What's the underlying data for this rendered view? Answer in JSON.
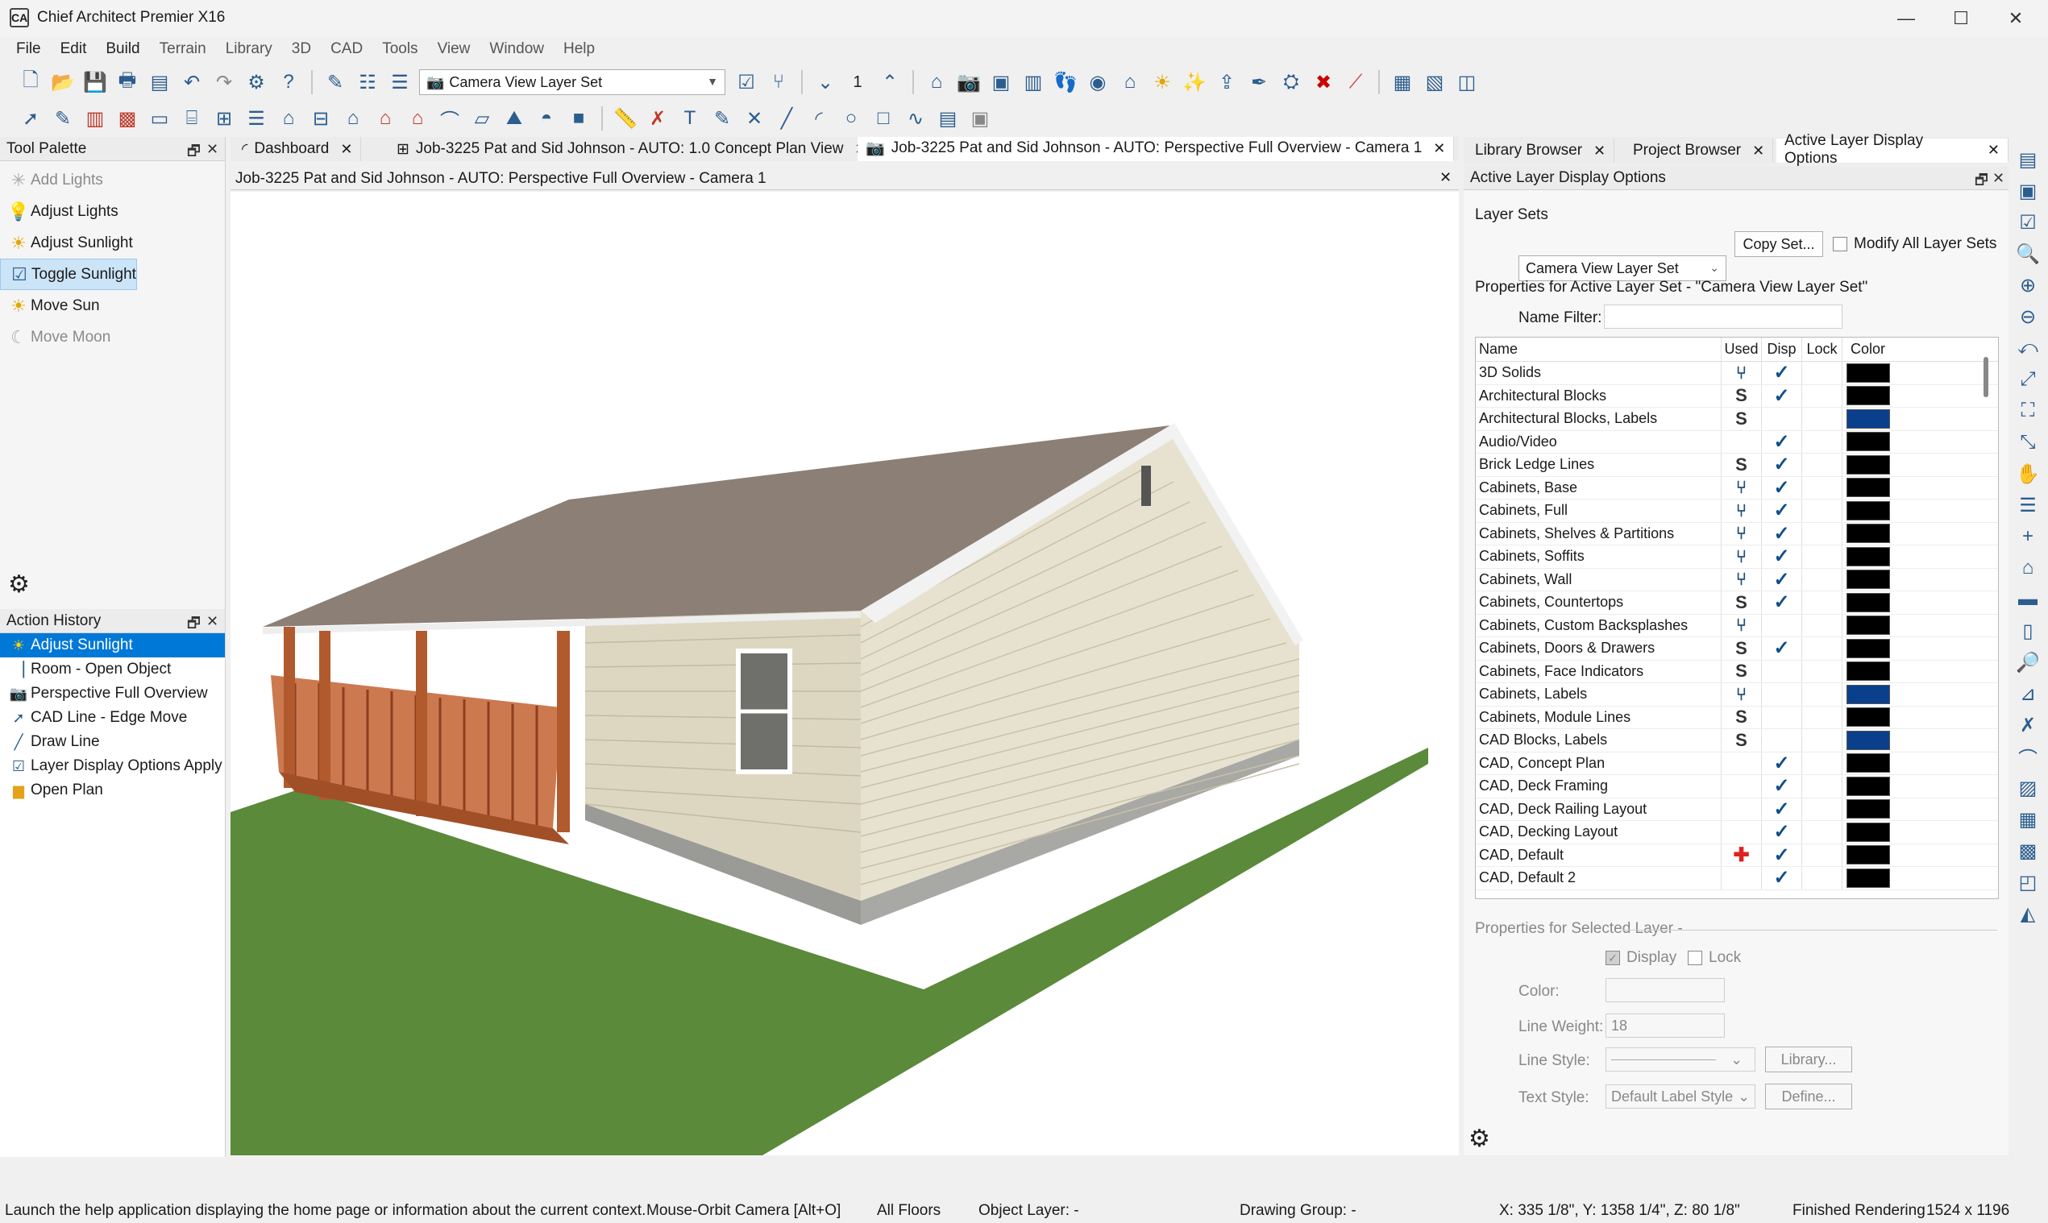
{
  "app": {
    "title": "Chief Architect Premier X16"
  },
  "window_controls": {
    "minimize": "—",
    "maximize": "☐",
    "close": "✕"
  },
  "menu": [
    "File",
    "Edit",
    "Build",
    "Terrain",
    "Library",
    "3D",
    "CAD",
    "Tools",
    "View",
    "Window",
    "Help"
  ],
  "toolbar": {
    "layer_set": "Camera View Layer Set",
    "floor_number": "1"
  },
  "tool_palette": {
    "title": "Tool Palette",
    "items": [
      {
        "label": "Add Lights",
        "icon": "add-light-icon",
        "state": "disabled"
      },
      {
        "label": "Adjust Lights",
        "icon": "adjust-lights-icon",
        "state": "normal"
      },
      {
        "label": "Adjust Sunlight",
        "icon": "adjust-sunlight-icon",
        "state": "normal"
      },
      {
        "label": "Toggle Sunlight",
        "icon": "toggle-sunlight-icon",
        "state": "selected"
      },
      {
        "label": "Move Sun",
        "icon": "sun-icon",
        "state": "normal"
      },
      {
        "label": "Move Moon",
        "icon": "moon-icon",
        "state": "disabled"
      }
    ]
  },
  "action_history": {
    "title": "Action History",
    "items": [
      {
        "label": "Adjust Sunlight",
        "selected": true
      },
      {
        "label": "Room - Open Object",
        "selected": false
      },
      {
        "label": "Perspective Full Overview",
        "selected": false
      },
      {
        "label": "CAD Line - Edge Move",
        "selected": false
      },
      {
        "label": "Draw Line",
        "selected": false
      },
      {
        "label": "Layer Display Options Apply",
        "selected": false
      },
      {
        "label": "Open Plan",
        "selected": false
      }
    ]
  },
  "doc_tabs": [
    {
      "label": "Dashboard",
      "active": false
    },
    {
      "label": "Job-3225 Pat and Sid Johnson - AUTO: 1.0 Concept Plan View",
      "active": false
    },
    {
      "label": "Job-3225 Pat and Sid Johnson - AUTO: Perspective Full Overview - Camera 1",
      "active": true
    }
  ],
  "view": {
    "title": "Job-3225 Pat and Sid Johnson - AUTO: Perspective Full Overview - Camera 1"
  },
  "right_tabs": [
    {
      "label": "Library Browser",
      "active": false
    },
    {
      "label": "Project Browser",
      "active": false
    },
    {
      "label": "Active Layer Display Options",
      "active": true
    }
  ],
  "layer_panel": {
    "title": "Active Layer Display Options",
    "layer_sets_label": "Layer Sets",
    "layer_set_value": "Camera View Layer Set",
    "copy_set_button": "Copy Set...",
    "modify_all_label": "Modify All Layer Sets",
    "properties_label": "Properties for Active Layer Set - \"Camera View Layer Set\"",
    "name_filter_label": "Name Filter:",
    "name_filter_value": "",
    "columns": {
      "name": "Name",
      "used": "Used",
      "disp": "Disp",
      "lock": "Lock",
      "color": "Color"
    },
    "rows": [
      {
        "name": "3D Solids",
        "used": "fork",
        "disp": true,
        "color": "#000000"
      },
      {
        "name": "Architectural Blocks",
        "used": "S",
        "disp": true,
        "color": "#000000"
      },
      {
        "name": "Architectural Blocks, Labels",
        "used": "S",
        "disp": false,
        "color": "#0a3f8c"
      },
      {
        "name": "Audio/Video",
        "used": "",
        "disp": true,
        "color": "#000000"
      },
      {
        "name": "Brick Ledge Lines",
        "used": "S",
        "disp": true,
        "color": "#000000"
      },
      {
        "name": "Cabinets,  Base",
        "used": "fork",
        "disp": true,
        "color": "#000000"
      },
      {
        "name": "Cabinets,  Full",
        "used": "fork",
        "disp": true,
        "color": "#000000"
      },
      {
        "name": "Cabinets,  Shelves & Partitions",
        "used": "fork",
        "disp": true,
        "color": "#000000"
      },
      {
        "name": "Cabinets,  Soffits",
        "used": "fork",
        "disp": true,
        "color": "#000000"
      },
      {
        "name": "Cabinets,  Wall",
        "used": "fork",
        "disp": true,
        "color": "#000000"
      },
      {
        "name": "Cabinets, Countertops",
        "used": "S",
        "disp": true,
        "color": "#000000"
      },
      {
        "name": "Cabinets, Custom Backsplashes",
        "used": "fork",
        "disp": false,
        "color": "#000000"
      },
      {
        "name": "Cabinets, Doors & Drawers",
        "used": "S",
        "disp": true,
        "color": "#000000"
      },
      {
        "name": "Cabinets, Face Indicators",
        "used": "S",
        "disp": false,
        "color": "#000000"
      },
      {
        "name": "Cabinets, Labels",
        "used": "fork",
        "disp": false,
        "color": "#0a3f8c"
      },
      {
        "name": "Cabinets, Module Lines",
        "used": "S",
        "disp": false,
        "color": "#000000"
      },
      {
        "name": "CAD Blocks, Labels",
        "used": "S",
        "disp": false,
        "color": "#0a3f8c"
      },
      {
        "name": "CAD,  Concept Plan",
        "used": "",
        "disp": true,
        "color": "#000000"
      },
      {
        "name": "CAD,  Deck Framing",
        "used": "",
        "disp": true,
        "color": "#000000"
      },
      {
        "name": "CAD,  Deck Railing Layout",
        "used": "",
        "disp": true,
        "color": "#000000"
      },
      {
        "name": "CAD,  Decking Layout",
        "used": "",
        "disp": true,
        "color": "#000000"
      },
      {
        "name": "CAD,  Default",
        "used": "plus",
        "disp": true,
        "color": "#000000"
      },
      {
        "name": "CAD,  Default 2",
        "used": "",
        "disp": true,
        "color": "#000000"
      }
    ],
    "selected_layer_label": "Properties for Selected Layer -",
    "display_label": "Display",
    "lock_label": "Lock",
    "color_label": "Color:",
    "line_weight_label": "Line Weight:",
    "line_weight_value": "18",
    "line_style_label": "Line Style:",
    "library_button": "Library...",
    "text_style_label": "Text Style:",
    "text_style_value": "Default Label Style",
    "define_button": "Define..."
  },
  "status": {
    "help": "Launch the help application displaying the home page or information about the current context.",
    "mode": "Mouse-Orbit Camera [Alt+O]",
    "floors": "All Floors",
    "object_layer": "Object Layer: -",
    "drawing_group": "Drawing Group: -",
    "coords": "X: 335 1/8\", Y: 1358 1/4\", Z: 80 1/8\"",
    "render": "Finished Rendering",
    "size": "1524 x 1196"
  },
  "colors": {
    "accent": "#0078d7",
    "grass": "#5a8a3a",
    "siding": "#e8e2cf",
    "roof": "#8c7f76",
    "deck": "#c0643a"
  }
}
